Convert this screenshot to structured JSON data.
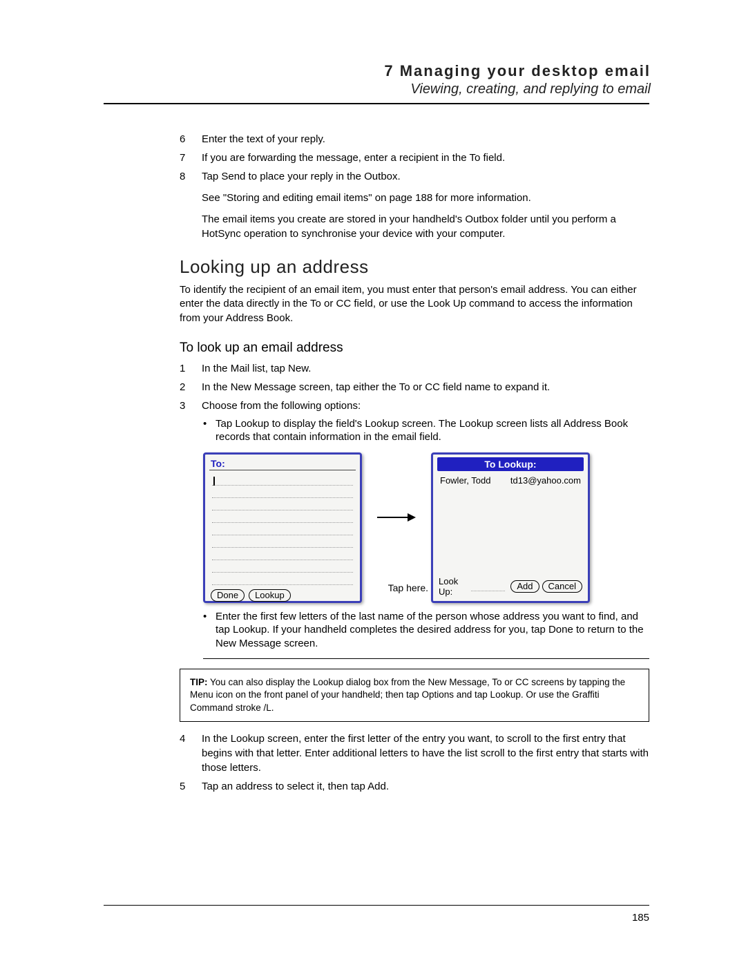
{
  "header": {
    "chapter": "7 Managing your desktop email",
    "section": "Viewing, creating, and replying to email"
  },
  "steps_top": [
    {
      "n": "6",
      "t": "Enter the text of your reply."
    },
    {
      "n": "7",
      "t": "If you are forwarding the message, enter a recipient in the To field."
    },
    {
      "n": "8",
      "t": "Tap Send to place your reply in the Outbox."
    }
  ],
  "after8_a": "See \"Storing and editing email items\" on page 188 for more information.",
  "after8_b": "The email items you create are stored in your handheld's Outbox folder until you perform a HotSync operation to synchronise your device with your computer.",
  "h2": "Looking up an address",
  "h2_para": "To identify the recipient of an email item, you must enter that person's email address. You can either enter the data directly in the To or CC field, or use the Look Up command to access the information from your Address Book.",
  "h3": "To look up an email address",
  "steps_bottom": [
    {
      "n": "1",
      "t": "In the Mail list, tap New."
    },
    {
      "n": "2",
      "t": "In the New Message screen, tap either the To or CC field name to expand it."
    },
    {
      "n": "3",
      "t": "Choose from the following options:"
    }
  ],
  "bullet_a": "Tap Lookup to display the field's Lookup screen. The Lookup screen lists all Address Book records that contain information in the email field.",
  "bullet_b": "Enter the first few letters of the last name of the person whose address you want to find, and tap Lookup. If your handheld completes the desired address for you, tap Done to return to the New Message screen.",
  "screen_left": {
    "title": "To:",
    "done": "Done",
    "lookup": "Lookup"
  },
  "arrow_label": "Tap here.",
  "screen_right": {
    "title": "To Lookup:",
    "name": "Fowler, Todd",
    "email": "td13@yahoo.com",
    "lookup_label": "Look Up:",
    "add": "Add",
    "cancel": "Cancel"
  },
  "tip": {
    "label": "TIP:",
    "text": "You can also display the Lookup dialog box from the New Message, To or CC screens by tapping the Menu icon on the front panel of your handheld; then tap Options and tap Lookup. Or use the Graffiti Command stroke /L."
  },
  "steps_after": [
    {
      "n": "4",
      "t": "In the Lookup screen, enter the first letter of the entry you want, to scroll to the first entry that begins with that letter. Enter additional letters to have the list scroll to the first entry that starts with those letters."
    },
    {
      "n": "5",
      "t": "Tap an address to select it, then tap Add."
    }
  ],
  "page_number": "185"
}
